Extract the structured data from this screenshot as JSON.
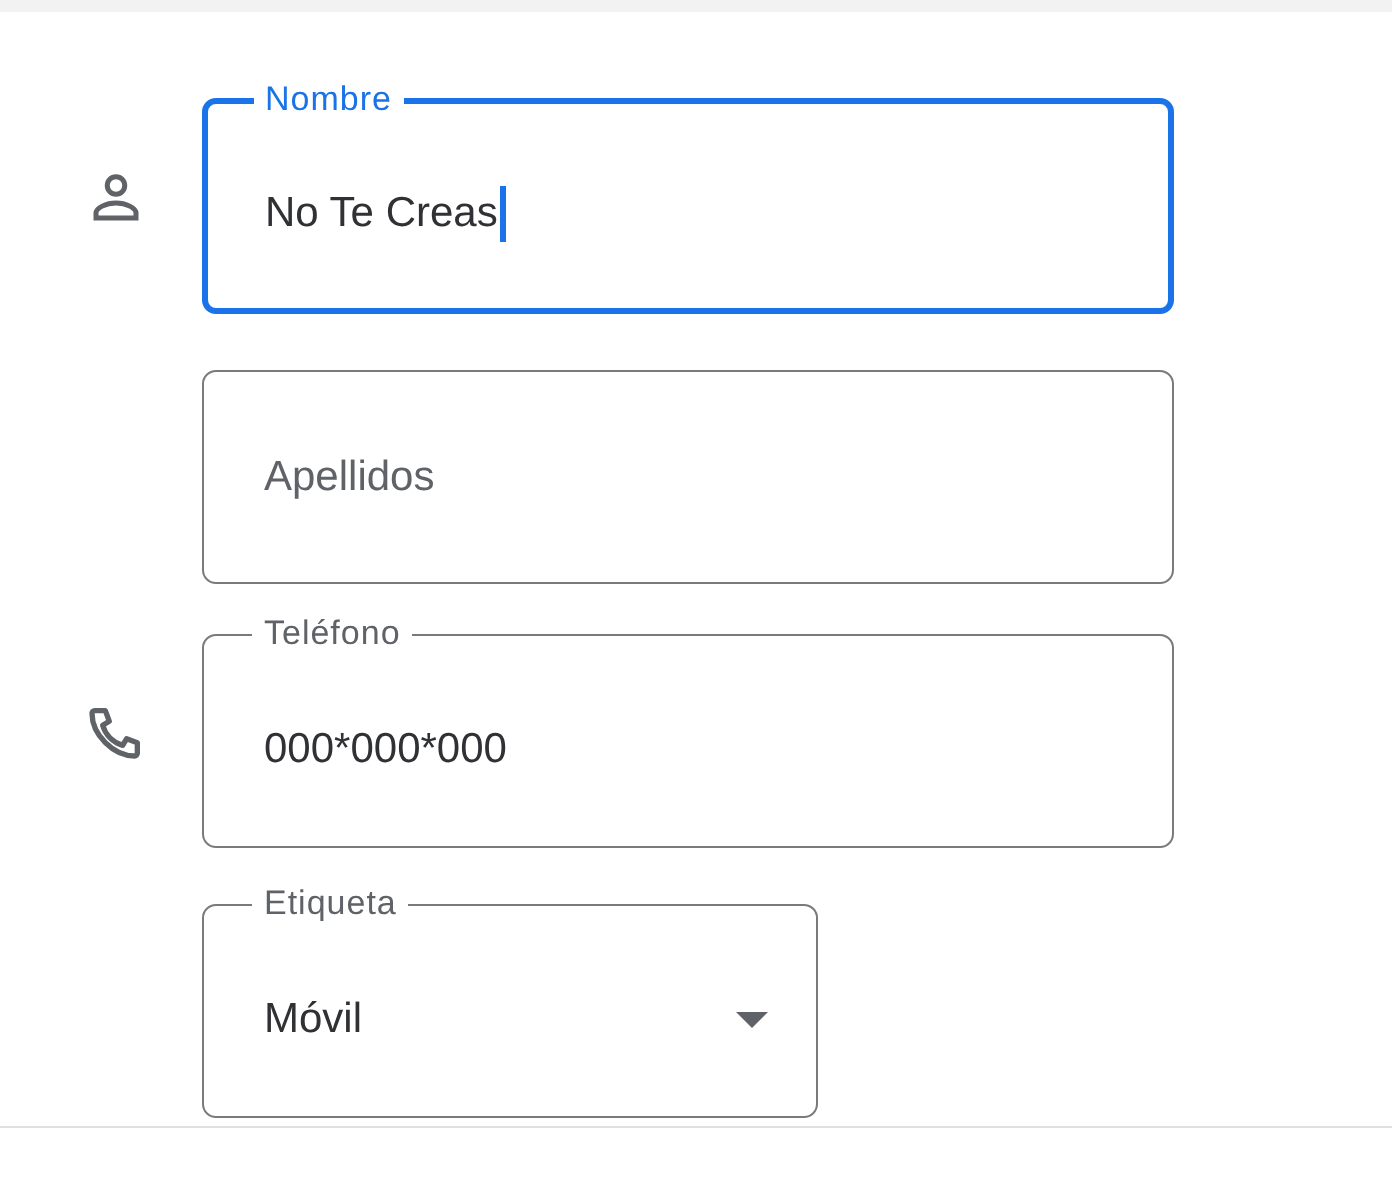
{
  "groups": [
    {
      "kind": "person",
      "fields": [
        {
          "kind": "text",
          "label": "Nombre",
          "value": "No Te Creas",
          "focused": true
        },
        {
          "kind": "text",
          "placeholder": "Apellidos",
          "focused": false
        }
      ]
    },
    {
      "kind": "phone",
      "fields": [
        {
          "kind": "text",
          "label": "Teléfono",
          "value": "000*000*000",
          "focused": false
        },
        {
          "kind": "select",
          "label": "Etiqueta",
          "value": "Móvil",
          "focused": false
        }
      ]
    }
  ]
}
